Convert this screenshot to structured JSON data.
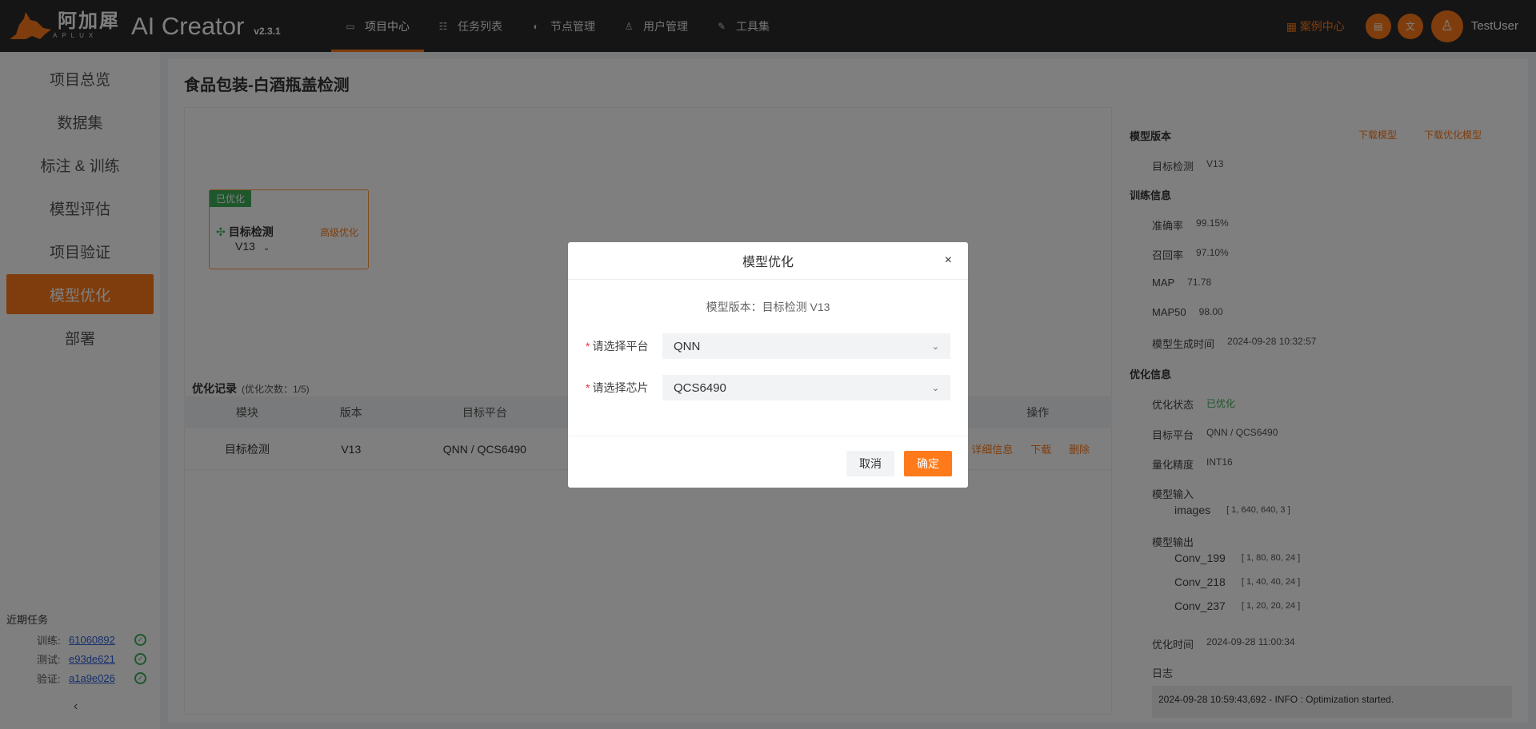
{
  "header": {
    "brand_cn": "阿加犀",
    "brand_sub": "APLUX",
    "app_title": "AI Creator",
    "version": "v2.3.1",
    "nav": [
      {
        "label": "项目中心",
        "icon": "▭"
      },
      {
        "label": "任务列表",
        "icon": "☷"
      },
      {
        "label": "节点管理",
        "icon": "◐"
      },
      {
        "label": "用户管理",
        "icon": "♙"
      },
      {
        "label": "工具集",
        "icon": "✎"
      }
    ],
    "case_center": "案例中心",
    "username": "TestUser"
  },
  "sidebar": {
    "items": [
      "项目总览",
      "数据集",
      "标注 & 训练",
      "模型评估",
      "项目验证",
      "模型优化",
      "部署"
    ],
    "active_index": 5,
    "recent_title": "近期任务",
    "recent": [
      {
        "label": "训练:",
        "id": "61060892"
      },
      {
        "label": "测试:",
        "id": "e93de621"
      },
      {
        "label": "验证:",
        "id": "a1a9e026"
      }
    ]
  },
  "main": {
    "title": "食品包装-白酒瓶盖检测",
    "node": {
      "tag": "已优化",
      "name": "目标检测",
      "advanced": "高级优化",
      "version": "V13"
    },
    "records_title": "优化记录",
    "records_count": "(优化次数：1/5)",
    "table": {
      "headers": [
        "模块",
        "版本",
        "目标平台",
        "",
        "操作"
      ],
      "rows": [
        {
          "module": "目标检测",
          "version": "V13",
          "platform": "QNN / QCS6490",
          "ops": [
            "详细信息",
            "下载",
            "删除"
          ]
        }
      ]
    }
  },
  "info": {
    "model_version_title": "模型版本",
    "download_model": "下载模型",
    "download_opt_model": "下载优化模型",
    "model_type": "目标检测",
    "model_ver": "V13",
    "train_title": "训练信息",
    "precision_k": "准确率",
    "precision_v": "99.15%",
    "recall_k": "召回率",
    "recall_v": "97.10%",
    "map_k": "MAP",
    "map_v": "71.78",
    "map50_k": "MAP50",
    "map50_v": "98.00",
    "gen_time_k": "模型生成时间",
    "gen_time_v": "2024-09-28 10:32:57",
    "opt_title": "优化信息",
    "status_k": "优化状态",
    "status_v": "已优化",
    "platform_k": "目标平台",
    "platform_v": "QNN / QCS6490",
    "quant_k": "量化精度",
    "quant_v": "INT16",
    "input_k": "模型输入",
    "input_name": "images",
    "input_shape": "[ 1, 640, 640, 3 ]",
    "output_k": "模型输出",
    "outputs": [
      {
        "name": "Conv_199",
        "shape": "[ 1, 80, 80, 24 ]"
      },
      {
        "name": "Conv_218",
        "shape": "[ 1, 40, 40, 24 ]"
      },
      {
        "name": "Conv_237",
        "shape": "[ 1, 20, 20, 24 ]"
      }
    ],
    "opt_time_k": "优化时间",
    "opt_time_v": "2024-09-28 11:00:34",
    "log_k": "日志",
    "log_line": "2024-09-28 10:59:43,692 - INFO : Optimization started."
  },
  "modal": {
    "title": "模型优化",
    "close": "×",
    "subtitle": "模型版本：目标检测 V13",
    "platform_label": "请选择平台",
    "platform_value": "QNN",
    "chip_label": "请选择芯片",
    "chip_value": "QCS6490",
    "cancel": "取消",
    "ok": "确定"
  }
}
